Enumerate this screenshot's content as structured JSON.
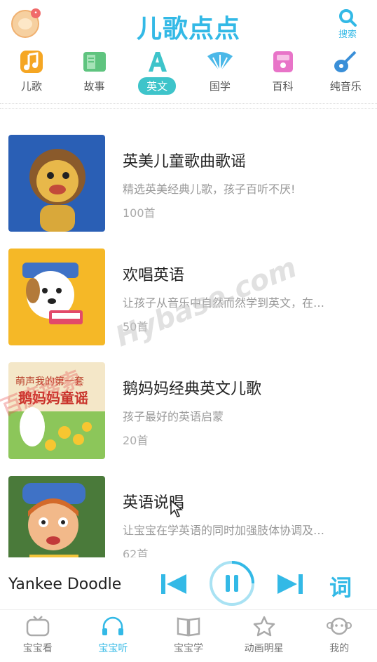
{
  "header": {
    "logo": "儿歌点点",
    "search_label": "搜索",
    "avatar_badge": "•"
  },
  "categories": [
    {
      "label": "儿歌",
      "icon": "music-note-icon",
      "active": false
    },
    {
      "label": "故事",
      "icon": "book-icon",
      "active": false
    },
    {
      "label": "英文",
      "icon": "letter-a-icon",
      "active": true
    },
    {
      "label": "国学",
      "icon": "fan-icon",
      "active": false
    },
    {
      "label": "百科",
      "icon": "encyclopedia-icon",
      "active": false
    },
    {
      "label": "纯音乐",
      "icon": "guitar-icon",
      "active": false
    }
  ],
  "items": [
    {
      "title": "英美儿童歌曲歌谣",
      "desc": "精选英美经典儿歌，孩子百听不厌!",
      "count": "100首"
    },
    {
      "title": "欢唱英语",
      "desc": "让孩子从音乐中自然而然学到英文，在…",
      "count": "50首"
    },
    {
      "title": "鹅妈妈经典英文儿歌",
      "desc": "孩子最好的英语启蒙",
      "count": "20首"
    },
    {
      "title": "英语说唱",
      "desc": "让宝宝在学英语的同时加强肢体协调及…",
      "count": "62首"
    }
  ],
  "thumb_text": {
    "goose_line1": "萌声我的第一套",
    "goose_line2": "鹅妈妈童谣"
  },
  "watermark": {
    "text1": "百度搜索",
    "text2": "Hybase.com"
  },
  "player": {
    "song": "Yankee Doodle",
    "lyrics_label": "词"
  },
  "nav": [
    {
      "label": "宝宝看",
      "active": false
    },
    {
      "label": "宝宝听",
      "active": true
    },
    {
      "label": "宝宝学",
      "active": false
    },
    {
      "label": "动画明星",
      "active": false
    },
    {
      "label": "我的",
      "active": false
    }
  ],
  "colors": {
    "accent": "#33b9e6",
    "active_tab": "#3ec4ca"
  }
}
